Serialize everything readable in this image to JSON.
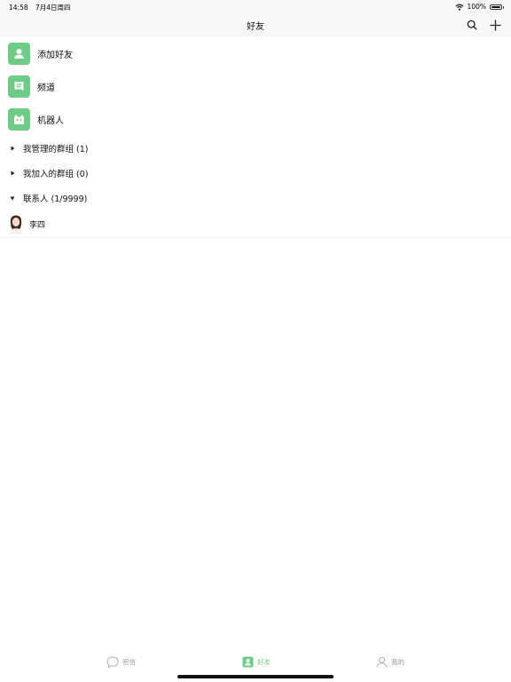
{
  "status_bar": {
    "time": "14:58",
    "date": "7月4日周四",
    "battery": "100%"
  },
  "header": {
    "title": "好友"
  },
  "entries": [
    {
      "label": "添加好友",
      "icon": "add-friend-icon"
    },
    {
      "label": "频道",
      "icon": "channel-icon"
    },
    {
      "label": "机器人",
      "icon": "robot-icon"
    }
  ],
  "groups": [
    {
      "label": "我管理的群组 (1)",
      "expanded": false
    },
    {
      "label": "我加入的群组 (0)",
      "expanded": false
    },
    {
      "label": "联系人 (1/9999)",
      "expanded": true
    }
  ],
  "contacts": [
    {
      "name": "李四"
    }
  ],
  "tabs": [
    {
      "label": "密信",
      "icon": "chat-bubble-icon",
      "active": false
    },
    {
      "label": "好友",
      "icon": "contacts-icon",
      "active": true
    },
    {
      "label": "我的",
      "icon": "profile-icon",
      "active": false
    }
  ],
  "colors": {
    "accent": "#6dcc86",
    "bar_background": "#f7f7f7",
    "inactive_tab": "#9a9a9a"
  }
}
